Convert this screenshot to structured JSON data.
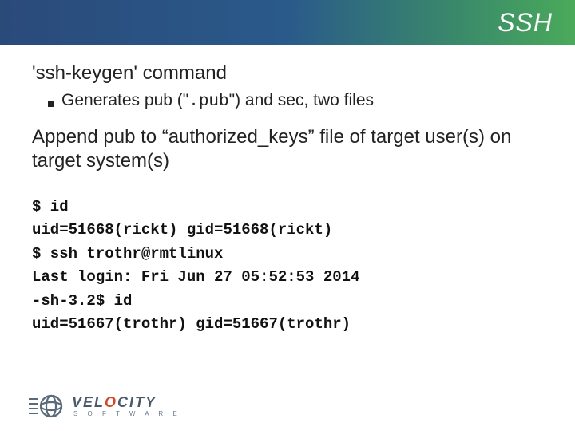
{
  "header": {
    "title": "SSH"
  },
  "body": {
    "section1_title": "'ssh-keygen' command",
    "bullet1_pre": "Generates pub (\"",
    "bullet1_code": ".pub",
    "bullet1_post": "\") and sec, two files",
    "para1": "Append pub to “authorized_keys” file of target user(s) on target system(s)"
  },
  "terminal": {
    "l1": "$ id",
    "l2": "uid=51668(rickt) gid=51668(rickt)",
    "l3": "$ ssh trothr@rmtlinux",
    "l4": "Last login: Fri Jun 27 05:52:53 2014",
    "l5": "-sh-3.2$ id",
    "l6": "uid=51667(trothr) gid=51667(trothr)"
  },
  "logo": {
    "word_pre": "VEL",
    "word_accent": "O",
    "word_post": "CITY",
    "sub": "S O F T W A R E"
  },
  "colors": {
    "header_grad_start": "#2a4a7a",
    "header_grad_end": "#4aaa5a",
    "logo_accent": "#d04a2a"
  }
}
